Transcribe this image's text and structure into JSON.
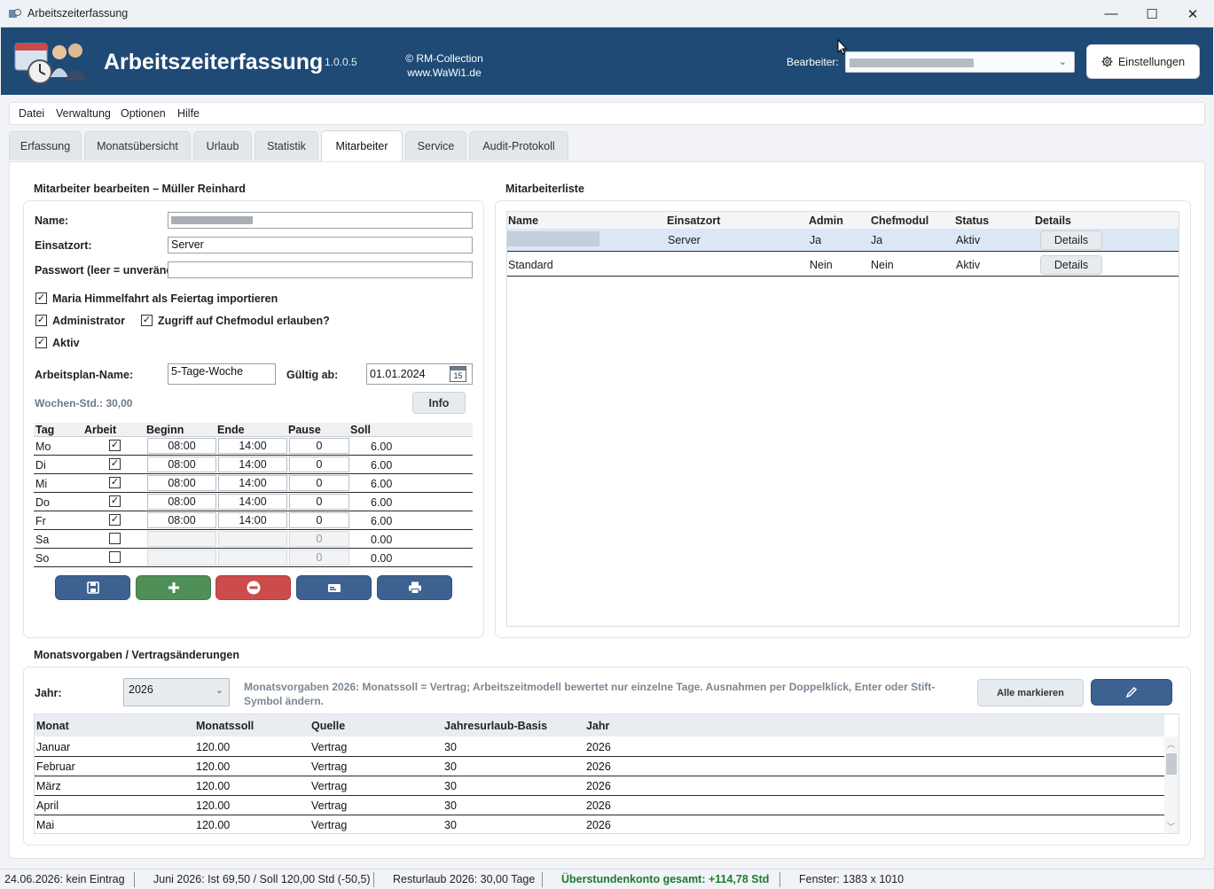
{
  "window": {
    "title": "Arbeitszeiterfassung",
    "minimize": "—",
    "maximize": "☐",
    "close": "✕"
  },
  "header": {
    "app_title": "Arbeitszeiterfassung",
    "version": "1.0.0.5",
    "copyright_line1": "© RM-Collection",
    "copyright_line2": "www.WaWi1.de",
    "bearbeiter_label": "Bearbeiter:",
    "settings_label": "Einstellungen"
  },
  "menu": [
    "Datei",
    "Verwaltung",
    "Optionen",
    "Hilfe"
  ],
  "tabs": [
    "Erfassung",
    "Monatsübersicht",
    "Urlaub",
    "Statistik",
    "Mitarbeiter",
    "Service",
    "Audit-Protokoll"
  ],
  "active_tab": "Mitarbeiter",
  "edit": {
    "section_title": "Mitarbeiter bearbeiten – Müller Reinhard",
    "name_label": "Name:",
    "einsatzort_label": "Einsatzort:",
    "einsatzort_value": "Server",
    "passwort_label": "Passwort (leer = unverände",
    "passwort_value": "",
    "cb_feiertag": "Maria Himmelfahrt als Feiertag importieren",
    "cb_feiertag_checked": true,
    "cb_admin": "Administrator",
    "cb_admin_checked": true,
    "cb_chef": "Zugriff auf Chefmodul erlauben?",
    "cb_chef_checked": true,
    "cb_aktiv": "Aktiv",
    "cb_aktiv_checked": true,
    "plan_name_label": "Arbeitsplan-Name:",
    "plan_name_value": "5-Tage-Woche",
    "gueltig_label": "Gültig ab:",
    "gueltig_value": "01.01.2024",
    "calendar_day": "15",
    "wochen_std": "Wochen-Std.: 30,00",
    "info_label": "Info"
  },
  "plan_table": {
    "headers": [
      "Tag",
      "Arbeit",
      "Beginn",
      "Ende",
      "Pause",
      "Soll"
    ],
    "rows": [
      {
        "tag": "Mo",
        "arbeit": true,
        "beginn": "08:00",
        "ende": "14:00",
        "pause": "0",
        "soll": "6.00"
      },
      {
        "tag": "Di",
        "arbeit": true,
        "beginn": "08:00",
        "ende": "14:00",
        "pause": "0",
        "soll": "6.00"
      },
      {
        "tag": "Mi",
        "arbeit": true,
        "beginn": "08:00",
        "ende": "14:00",
        "pause": "0",
        "soll": "6.00"
      },
      {
        "tag": "Do",
        "arbeit": true,
        "beginn": "08:00",
        "ende": "14:00",
        "pause": "0",
        "soll": "6.00"
      },
      {
        "tag": "Fr",
        "arbeit": true,
        "beginn": "08:00",
        "ende": "14:00",
        "pause": "0",
        "soll": "6.00"
      },
      {
        "tag": "Sa",
        "arbeit": false,
        "beginn": "",
        "ende": "",
        "pause": "0",
        "soll": "0.00"
      },
      {
        "tag": "So",
        "arbeit": false,
        "beginn": "",
        "ende": "",
        "pause": "0",
        "soll": "0.00"
      }
    ]
  },
  "action_buttons": [
    {
      "name": "save-button",
      "icon": "save-icon",
      "color": "#3d6291"
    },
    {
      "name": "add-button",
      "icon": "plus-icon",
      "color": "#4f8f58"
    },
    {
      "name": "remove-button",
      "icon": "minus-icon",
      "color": "#cc4b4b"
    },
    {
      "name": "card-button",
      "icon": "id-card-icon",
      "color": "#3d6291"
    },
    {
      "name": "print-button",
      "icon": "printer-icon",
      "color": "#3d6291"
    }
  ],
  "mlist": {
    "title": "Mitarbeiterliste",
    "headers": [
      "Name",
      "Einsatzort",
      "Admin",
      "Chefmodul",
      "Status",
      "Details"
    ],
    "rows": [
      {
        "name": "",
        "einsatzort": "Server",
        "admin": "Ja",
        "chef": "Ja",
        "status": "Aktiv",
        "details": "Details"
      },
      {
        "name": "Standard",
        "einsatzort": "",
        "admin": "Nein",
        "chef": "Nein",
        "status": "Aktiv",
        "details": "Details"
      }
    ]
  },
  "monats": {
    "title": "Monatsvorgaben / Vertragsänderungen",
    "jahr_label": "Jahr:",
    "jahr_value": "2026",
    "hint": "Monatsvorgaben 2026: Monatssoll = Vertrag; Arbeitszeitmodell bewertet nur einzelne Tage. Ausnahmen per Doppelklick, Enter oder Stift-Symbol ändern.",
    "alle_markieren": "Alle markieren",
    "headers": [
      "Monat",
      "Monatssoll",
      "Quelle",
      "Jahresurlaub-Basis",
      "Jahr"
    ],
    "rows": [
      {
        "monat": "Januar",
        "soll": "120.00",
        "quelle": "Vertrag",
        "basis": "30",
        "jahr": "2026"
      },
      {
        "monat": "Februar",
        "soll": "120.00",
        "quelle": "Vertrag",
        "basis": "30",
        "jahr": "2026"
      },
      {
        "monat": "März",
        "soll": "120.00",
        "quelle": "Vertrag",
        "basis": "30",
        "jahr": "2026"
      },
      {
        "monat": "April",
        "soll": "120.00",
        "quelle": "Vertrag",
        "basis": "30",
        "jahr": "2026"
      },
      {
        "monat": "Mai",
        "soll": "120.00",
        "quelle": "Vertrag",
        "basis": "30",
        "jahr": "2026"
      }
    ]
  },
  "status": {
    "s1": "24.06.2026: kein Eintrag",
    "s2": "Juni 2026: Ist 69,50 / Soll 120,00 Std (-50,5)",
    "s3": "Resturlaub 2026: 30,00 Tage",
    "s4": "Überstundenkonto gesamt: +114,78 Std",
    "s4_color": "#1f7a2e",
    "s5": "Fenster: 1383 x 1010"
  },
  "colors": {
    "header_bg": "#1e4a75",
    "selected_row": "#dbe7f5"
  }
}
